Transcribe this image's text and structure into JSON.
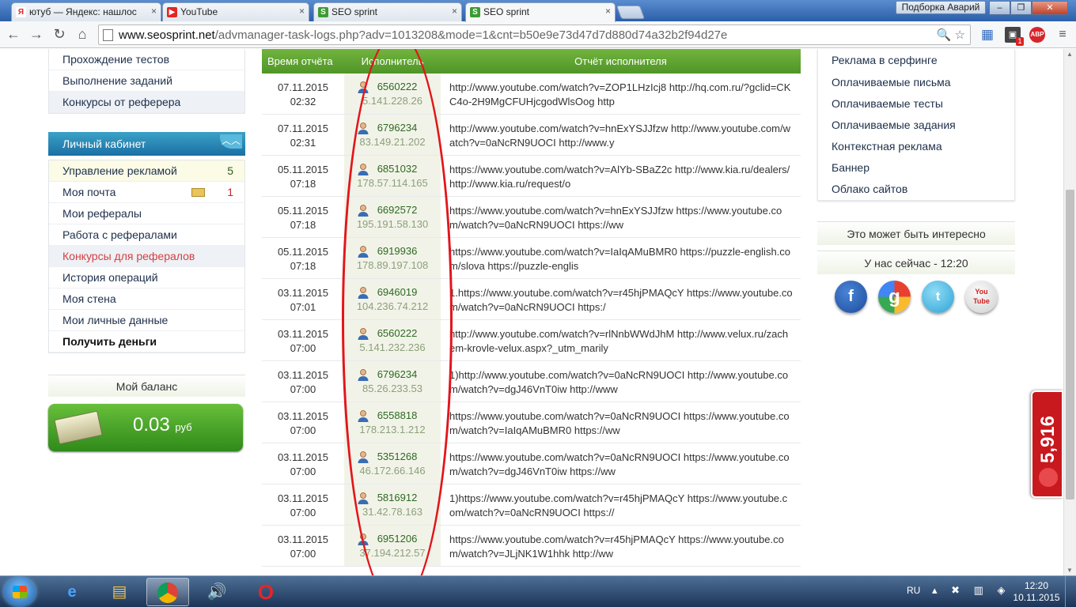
{
  "browser": {
    "tabs": [
      {
        "label": "ютуб — Яндекс: нашлос",
        "favicon": "Я",
        "color": "#e52620"
      },
      {
        "label": "YouTube",
        "favicon": "▶",
        "color": "#e52620"
      },
      {
        "label": "SEO sprint",
        "favicon": "S",
        "color": "#3d9b35"
      },
      {
        "label": "SEO sprint",
        "favicon": "S",
        "color": "#3d9b35"
      }
    ],
    "podborka": "Подборка Аварий",
    "url_host": "www.seosprint.net",
    "url_path": "/advmanager-task-logs.php?adv=1013208&mode=1&cnt=b50e9e73d47d7d880d74a32b2f94d27e",
    "ext_badge": "1",
    "abp": "ABP"
  },
  "left_menu_top": [
    "Прохождение тестов",
    "Выполнение заданий",
    "Конкурсы от реферера"
  ],
  "cabinet": {
    "title": "Личный кабинет",
    "items": [
      {
        "label": "Управление рекламой",
        "count": "5"
      },
      {
        "label": "Моя почта",
        "count": "1"
      },
      {
        "label": "Мои рефералы"
      },
      {
        "label": "Работа с рефералами"
      },
      {
        "label": "Конкурсы для рефералов"
      },
      {
        "label": "История операций"
      },
      {
        "label": "Моя стена"
      },
      {
        "label": "Мои личные данные"
      },
      {
        "label": "Получить деньги"
      }
    ]
  },
  "balance": {
    "title": "Мой баланс",
    "amount": "0.03",
    "unit": "руб"
  },
  "table": {
    "headers": [
      "Время отчёта",
      "Исполнитель",
      "Отчёт исполнителя"
    ],
    "rows": [
      {
        "date": "07.11.2015",
        "time": "02:32",
        "uid": "6560222",
        "ip": "5.141.228.26",
        "report": "http://www.youtube.com/watch?v=ZOP1LHzIcj8 http://hq.com.ru/?gclid=CKC4o-2H9MgCFUHjcgodWlsOog http"
      },
      {
        "date": "07.11.2015",
        "time": "02:31",
        "uid": "6796234",
        "ip": "83.149.21.202",
        "report": "http://www.youtube.com/watch?v=hnExYSJJfzw http://www.youtube.com/watch?v=0aNcRN9UOCI http://www.y"
      },
      {
        "date": "05.11.2015",
        "time": "07:18",
        "uid": "6851032",
        "ip": "178.57.114.165",
        "report": "https://www.youtube.com/watch?v=AlYb-SBaZ2c http://www.kia.ru/dealers/ http://www.kia.ru/request/o"
      },
      {
        "date": "05.11.2015",
        "time": "07:18",
        "uid": "6692572",
        "ip": "195.191.58.130",
        "report": "https://www.youtube.com/watch?v=hnExYSJJfzw https://www.youtube.com/watch?v=0aNcRN9UOCI https://ww"
      },
      {
        "date": "05.11.2015",
        "time": "07:18",
        "uid": "6919936",
        "ip": "178.89.197.108",
        "report": "https://www.youtube.com/watch?v=IaIqAMuBMR0 https://puzzle-english.com/slova https://puzzle-englis"
      },
      {
        "date": "03.11.2015",
        "time": "07:01",
        "uid": "6946019",
        "ip": "104.236.74.212",
        "report": "1.https://www.youtube.com/watch?v=r45hjPMAQcY https://www.youtube.com/watch?v=0aNcRN9UOCI https:/"
      },
      {
        "date": "03.11.2015",
        "time": "07:00",
        "uid": "6560222",
        "ip": "5.141.232.236",
        "report": "http://www.youtube.com/watch?v=rlNnbWWdJhM http://www.velux.ru/zachem-krovle-velux.aspx?_utm_marily"
      },
      {
        "date": "03.11.2015",
        "time": "07:00",
        "uid": "6796234",
        "ip": "85.26.233.53",
        "report": "1)http://www.youtube.com/watch?v=0aNcRN9UOCI http://www.youtube.com/watch?v=dgJ46VnT0iw http://www"
      },
      {
        "date": "03.11.2015",
        "time": "07:00",
        "uid": "6558818",
        "ip": "178.213.1.212",
        "report": "https://www.youtube.com/watch?v=0aNcRN9UOCI https://www.youtube.com/watch?v=IaIqAMuBMR0 https://ww"
      },
      {
        "date": "03.11.2015",
        "time": "07:00",
        "uid": "5351268",
        "ip": "46.172.66.146",
        "report": "https://www.youtube.com/watch?v=0aNcRN9UOCI https://www.youtube.com/watch?v=dgJ46VnT0iw https://ww"
      },
      {
        "date": "03.11.2015",
        "time": "07:00",
        "uid": "5816912",
        "ip": "31.42.78.163",
        "report": "1)https://www.youtube.com/watch?v=r45hjPMAQcY https://www.youtube.com/watch?v=0aNcRN9UOCI https://"
      },
      {
        "date": "03.11.2015",
        "time": "07:00",
        "uid": "6951206",
        "ip": "37.194.212.57",
        "report": "https://www.youtube.com/watch?v=r45hjPMAQcY https://www.youtube.com/watch?v=JLjNK1W1hhk http://ww"
      }
    ]
  },
  "right_menu": [
    "Реклама в серфинге",
    "Оплачиваемые письма",
    "Оплачиваемые тесты",
    "Оплачиваемые задания",
    "Контекстная реклама",
    "Баннер",
    "Облако сайтов"
  ],
  "right_info": {
    "interesting": "Это может быть интересно",
    "now": "У нас сейчас - 12:20"
  },
  "social": {
    "fb": "f",
    "gp": "g",
    "tw": "t",
    "yt_top": "You",
    "yt_bottom": "Tube"
  },
  "side_badge": "5,916",
  "taskbar": {
    "lang": "RU",
    "time": "12:20",
    "date": "10.11.2015"
  }
}
